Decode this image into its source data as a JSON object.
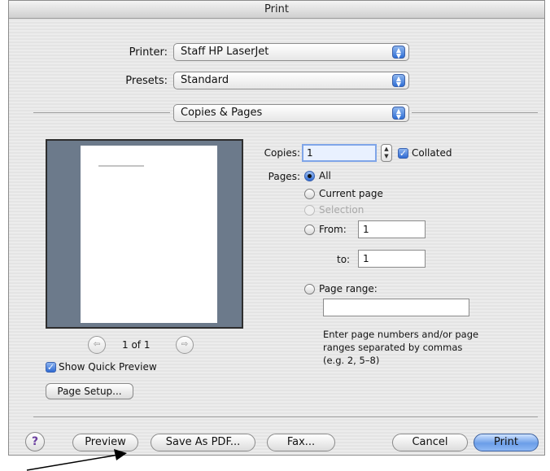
{
  "window": {
    "title": "Print"
  },
  "printer": {
    "label": "Printer:",
    "value": "Staff HP LaserJet"
  },
  "presets": {
    "label": "Presets:",
    "value": "Standard"
  },
  "panel": {
    "value": "Copies & Pages"
  },
  "preview": {
    "page_indicator": "1 of 1",
    "prev_icon": "back-arrow-icon",
    "next_icon": "forward-arrow-icon",
    "show_quick_preview": {
      "label": "Show Quick Preview",
      "checked": true
    }
  },
  "copies": {
    "label": "Copies:",
    "value": "1",
    "collated_label": "Collated",
    "collated_checked": true
  },
  "pages": {
    "label": "Pages:",
    "options": {
      "all": "All",
      "current": "Current page",
      "selection": "Selection",
      "from": "From:",
      "to": "to:",
      "range": "Page range:"
    },
    "selected": "all",
    "from_value": "1",
    "to_value": "1",
    "range_value": "",
    "hint": "Enter page numbers and/or page ranges separated by commas (e.g. 2, 5–8)"
  },
  "buttons": {
    "page_setup": "Page Setup...",
    "help": "?",
    "preview": "Preview",
    "save_pdf": "Save As PDF...",
    "fax": "Fax...",
    "cancel": "Cancel",
    "print": "Print"
  },
  "colors": {
    "accent": "#3d7de0",
    "preview_background": "#6c7a8b",
    "help_mark": "#6b3fa0"
  }
}
